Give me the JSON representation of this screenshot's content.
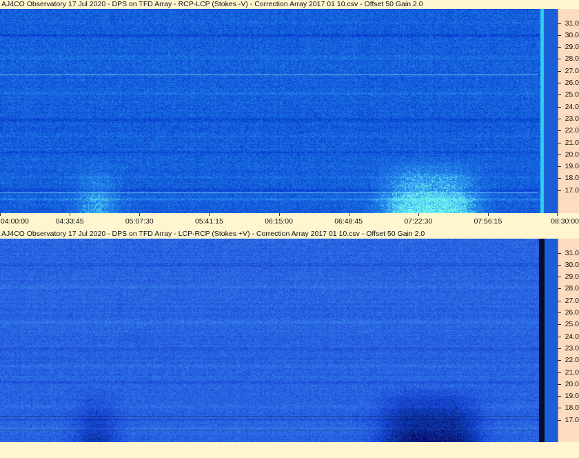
{
  "panels": [
    {
      "title": "AJ4CO Observatory 17 Jul 2020  -  DPS on TFD Array  -  RCP-LCP (Stokes -V)  -  Correction Array 2017 01 10.csv  -  Offset 50  Gain 2.0",
      "mode": "minus"
    },
    {
      "title": "AJ4CO Observatory 17 Jul 2020  -  DPS on TFD Array  -  LCP-RCP (Stokes +V)  -  Correction Array 2017 01 10.csv  -  Offset 50  Gain 2.0",
      "mode": "plus"
    }
  ],
  "freq_labels": [
    "31.0",
    "30.0",
    "29.0",
    "28.0",
    "27.0",
    "26.0",
    "25.0",
    "24.0",
    "23.0",
    "22.0",
    "21.0",
    "20.0",
    "19.0",
    "18.0",
    "17.0"
  ],
  "time_labels": [
    "04:00:00",
    "04:33:45",
    "05:07:30",
    "05:41:15",
    "06:15:00",
    "06:48:45",
    "07:22:30",
    "07:56:15",
    "08:30:00"
  ],
  "colors": {
    "background": "#fff6cf",
    "axis_panel": "#fbdcc0",
    "base_blue": "#2f6ee6"
  }
}
